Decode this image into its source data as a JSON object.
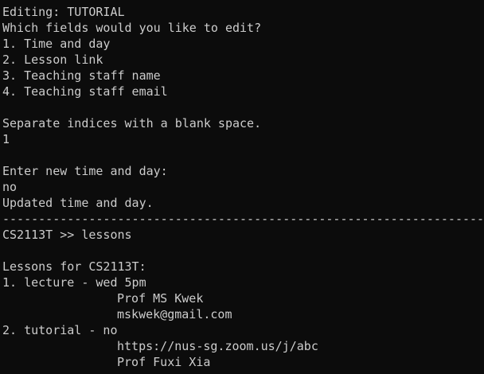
{
  "terminal": {
    "colors": {
      "background": "#0c0c0c",
      "text": "#cccccc"
    },
    "edit_prompt": {
      "editing": "Editing: TUTORIAL",
      "question": "Which fields would you like to edit?",
      "options": [
        "1. Time and day",
        "2. Lesson link",
        "3. Teaching staff name",
        "4. Teaching staff email"
      ],
      "separate_hint": "Separate indices with a blank space.",
      "indices_input": "1",
      "enter_prompt": "Enter new time and day:",
      "time_input": "no",
      "confirmation": "Updated time and day."
    },
    "divider": "------------------------------------------------------------------------------------------",
    "command": "CS2113T >> lessons",
    "lessons_output": {
      "header": "Lessons for CS2113T:",
      "lessons": [
        {
          "title": "1. lecture - wed 5pm",
          "details": [
            "Prof MS Kwek",
            "mskwek@gmail.com"
          ]
        },
        {
          "title": "2. tutorial - no",
          "details": [
            "https://nus-sg.zoom.us/j/abc",
            "Prof Fuxi Xia"
          ]
        }
      ]
    }
  }
}
